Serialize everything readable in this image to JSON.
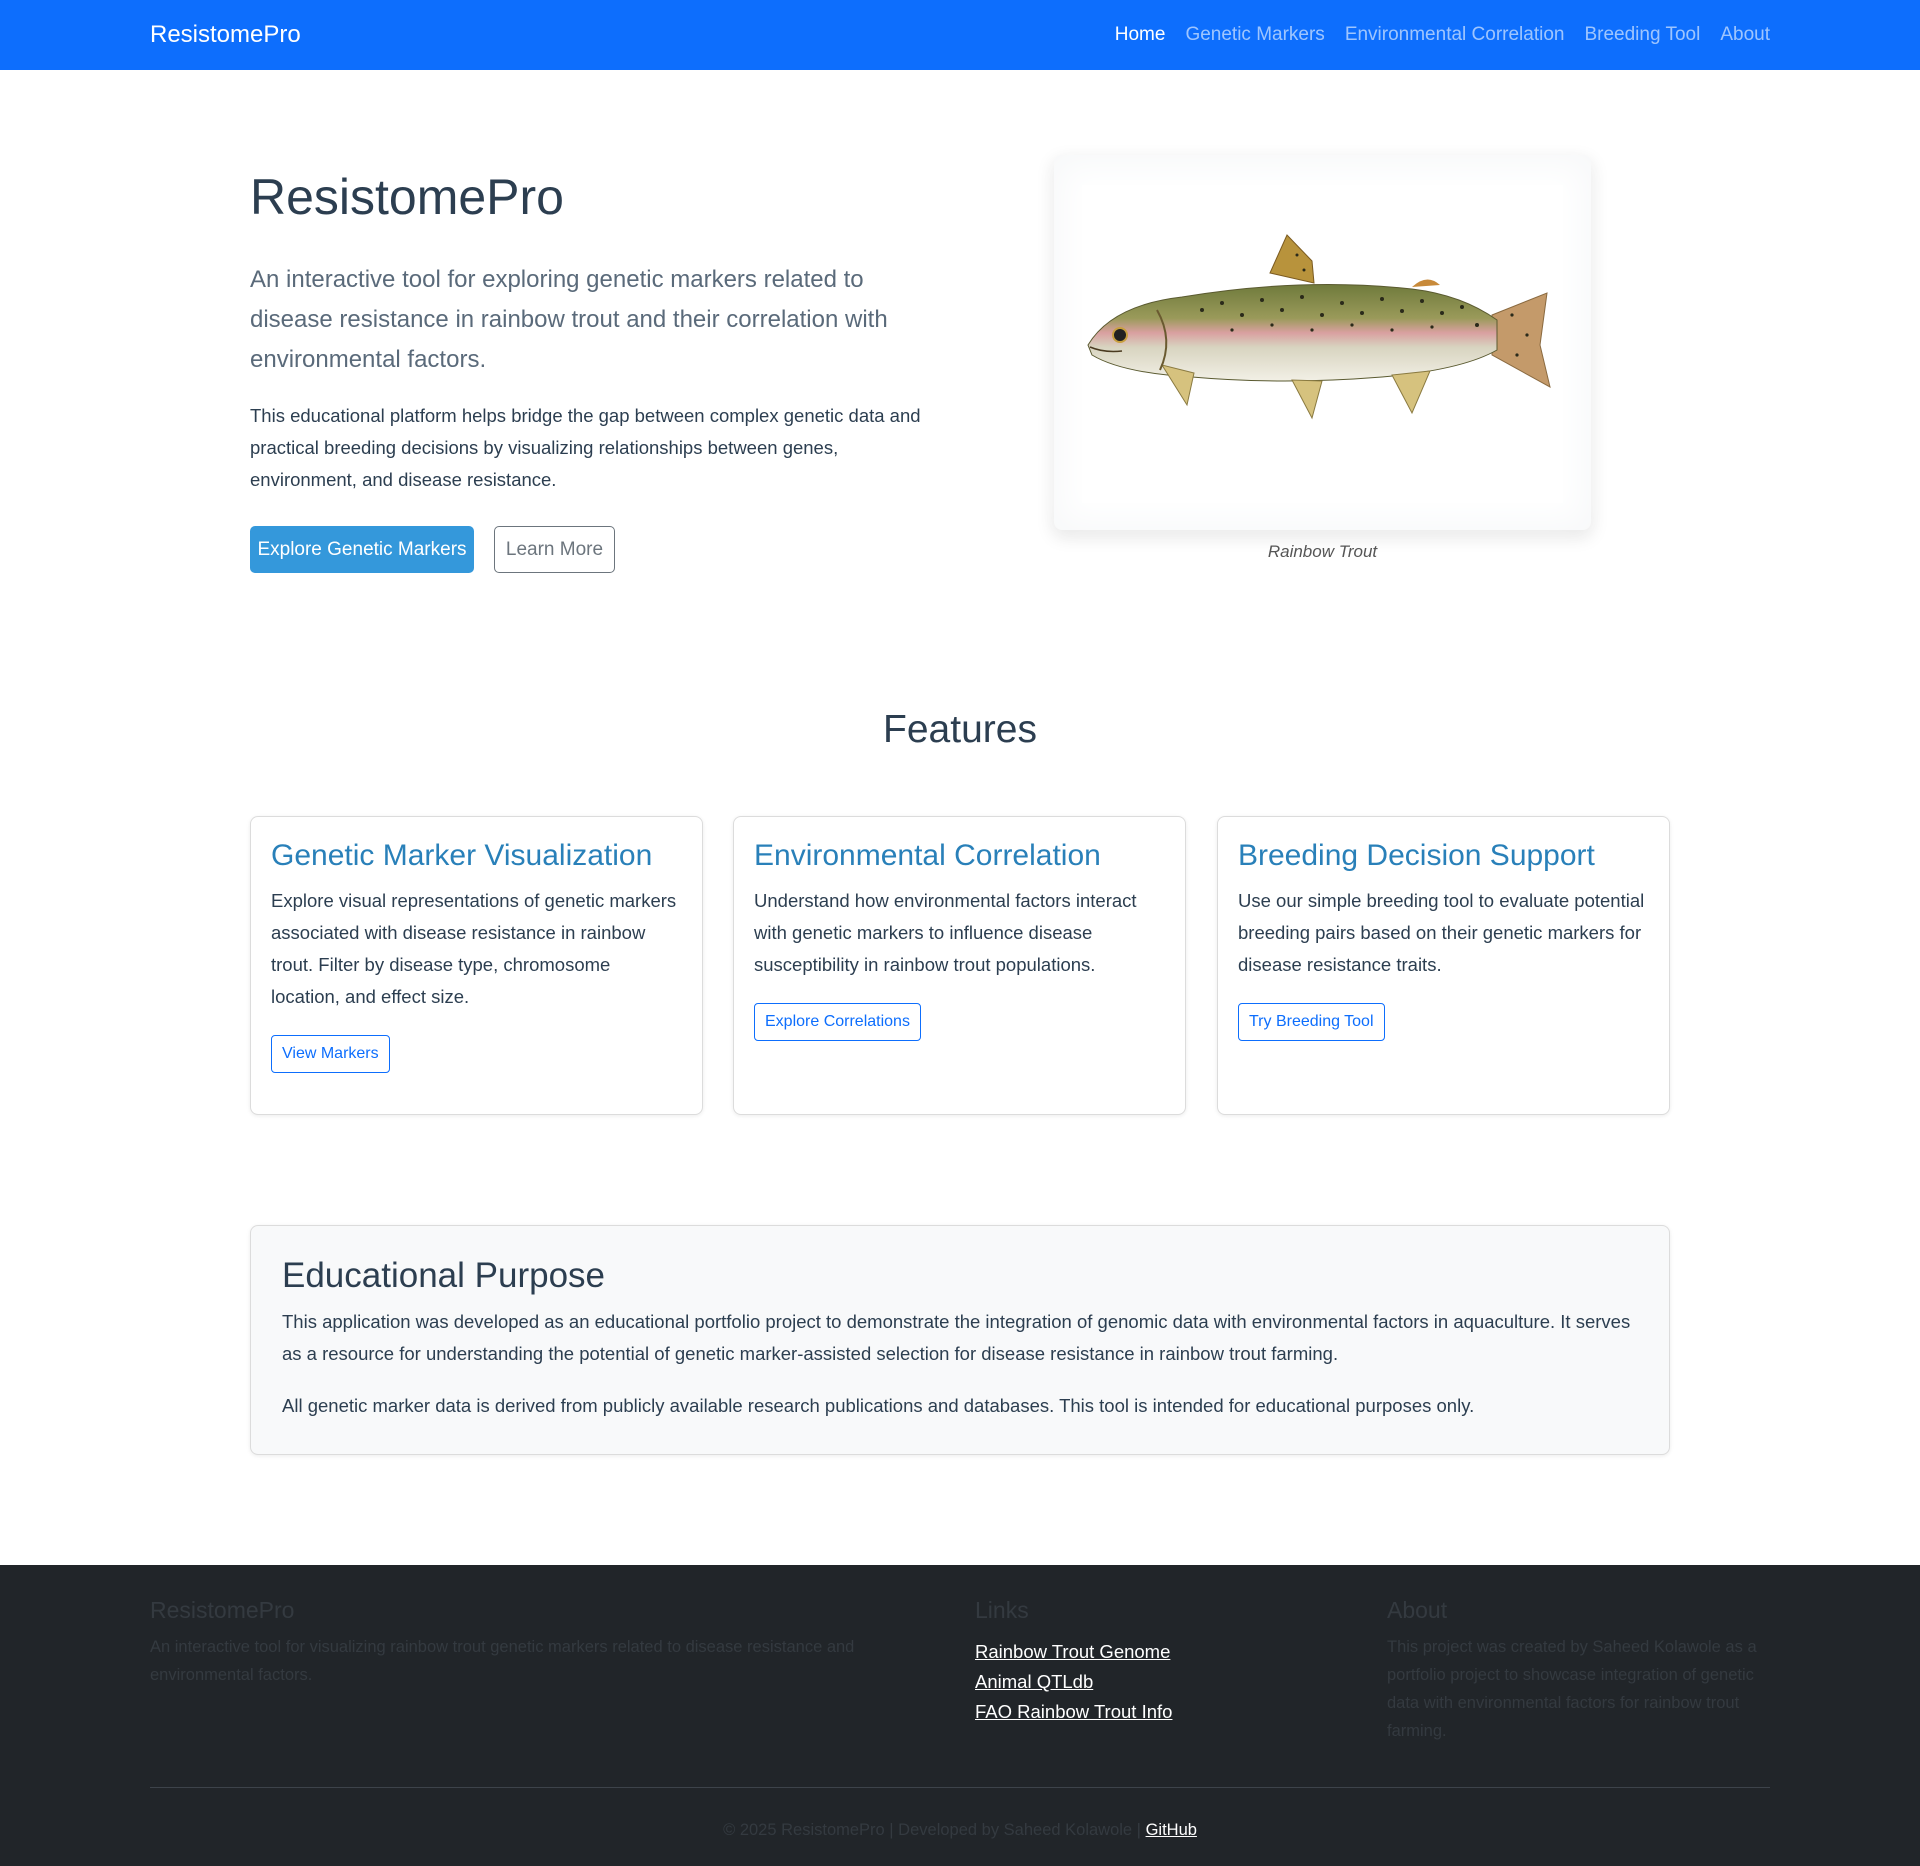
{
  "navbar": {
    "brand": "ResistomePro",
    "links": [
      {
        "label": "Home",
        "active": true
      },
      {
        "label": "Genetic Markers",
        "active": false
      },
      {
        "label": "Environmental Correlation",
        "active": false
      },
      {
        "label": "Breeding Tool",
        "active": false
      },
      {
        "label": "About",
        "active": false
      }
    ]
  },
  "hero": {
    "title": "ResistomePro",
    "lead": "An interactive tool for exploring genetic markers related to disease resistance in rainbow trout and their correlation with environmental factors.",
    "description": "This educational platform helps bridge the gap between complex genetic data and practical breeding decisions by visualizing relationships between genes, environment, and disease resistance.",
    "primary_button": "Explore Genetic Markers",
    "secondary_button": "Learn More",
    "image_caption": "Rainbow Trout"
  },
  "features": {
    "title": "Features",
    "cards": [
      {
        "title": "Genetic Marker Visualization",
        "text": "Explore visual representations of genetic markers associated with disease resistance in rainbow trout. Filter by disease type, chromosome location, and effect size.",
        "button": "View Markers"
      },
      {
        "title": "Environmental Correlation",
        "text": "Understand how environmental factors interact with genetic markers to influence disease susceptibility in rainbow trout populations.",
        "button": "Explore Correlations"
      },
      {
        "title": "Breeding Decision Support",
        "text": "Use our simple breeding tool to evaluate potential breeding pairs based on their genetic markers for disease resistance traits.",
        "button": "Try Breeding Tool"
      }
    ]
  },
  "educational": {
    "title": "Educational Purpose",
    "paragraph1": "This application was developed as an educational portfolio project to demonstrate the integration of genomic data with environmental factors in aquaculture. It serves as a resource for understanding the potential of genetic marker-assisted selection for disease resistance in rainbow trout farming.",
    "paragraph2": "All genetic marker data is derived from publicly available research publications and databases. This tool is intended for educational purposes only."
  },
  "footer": {
    "brand_title": "ResistomePro",
    "brand_text": "An interactive tool for visualizing rainbow trout genetic markers related to disease resistance and environmental factors.",
    "links_title": "Links",
    "links": [
      "Rainbow Trout Genome",
      "Animal QTLdb",
      "FAO Rainbow Trout Info"
    ],
    "about_title": "About",
    "about_text": "This project was created by Saheed Kolawole as a portfolio project to showcase integration of genetic data with environmental factors for rainbow trout farming.",
    "copyright": "© 2025 ResistomePro | Developed by Saheed Kolawole | ",
    "github": "GitHub"
  },
  "colors": {
    "navbar": "#0d6efd",
    "primary_button": "#3498db",
    "card_title": "#2980b9",
    "footer_bg": "#212529"
  }
}
